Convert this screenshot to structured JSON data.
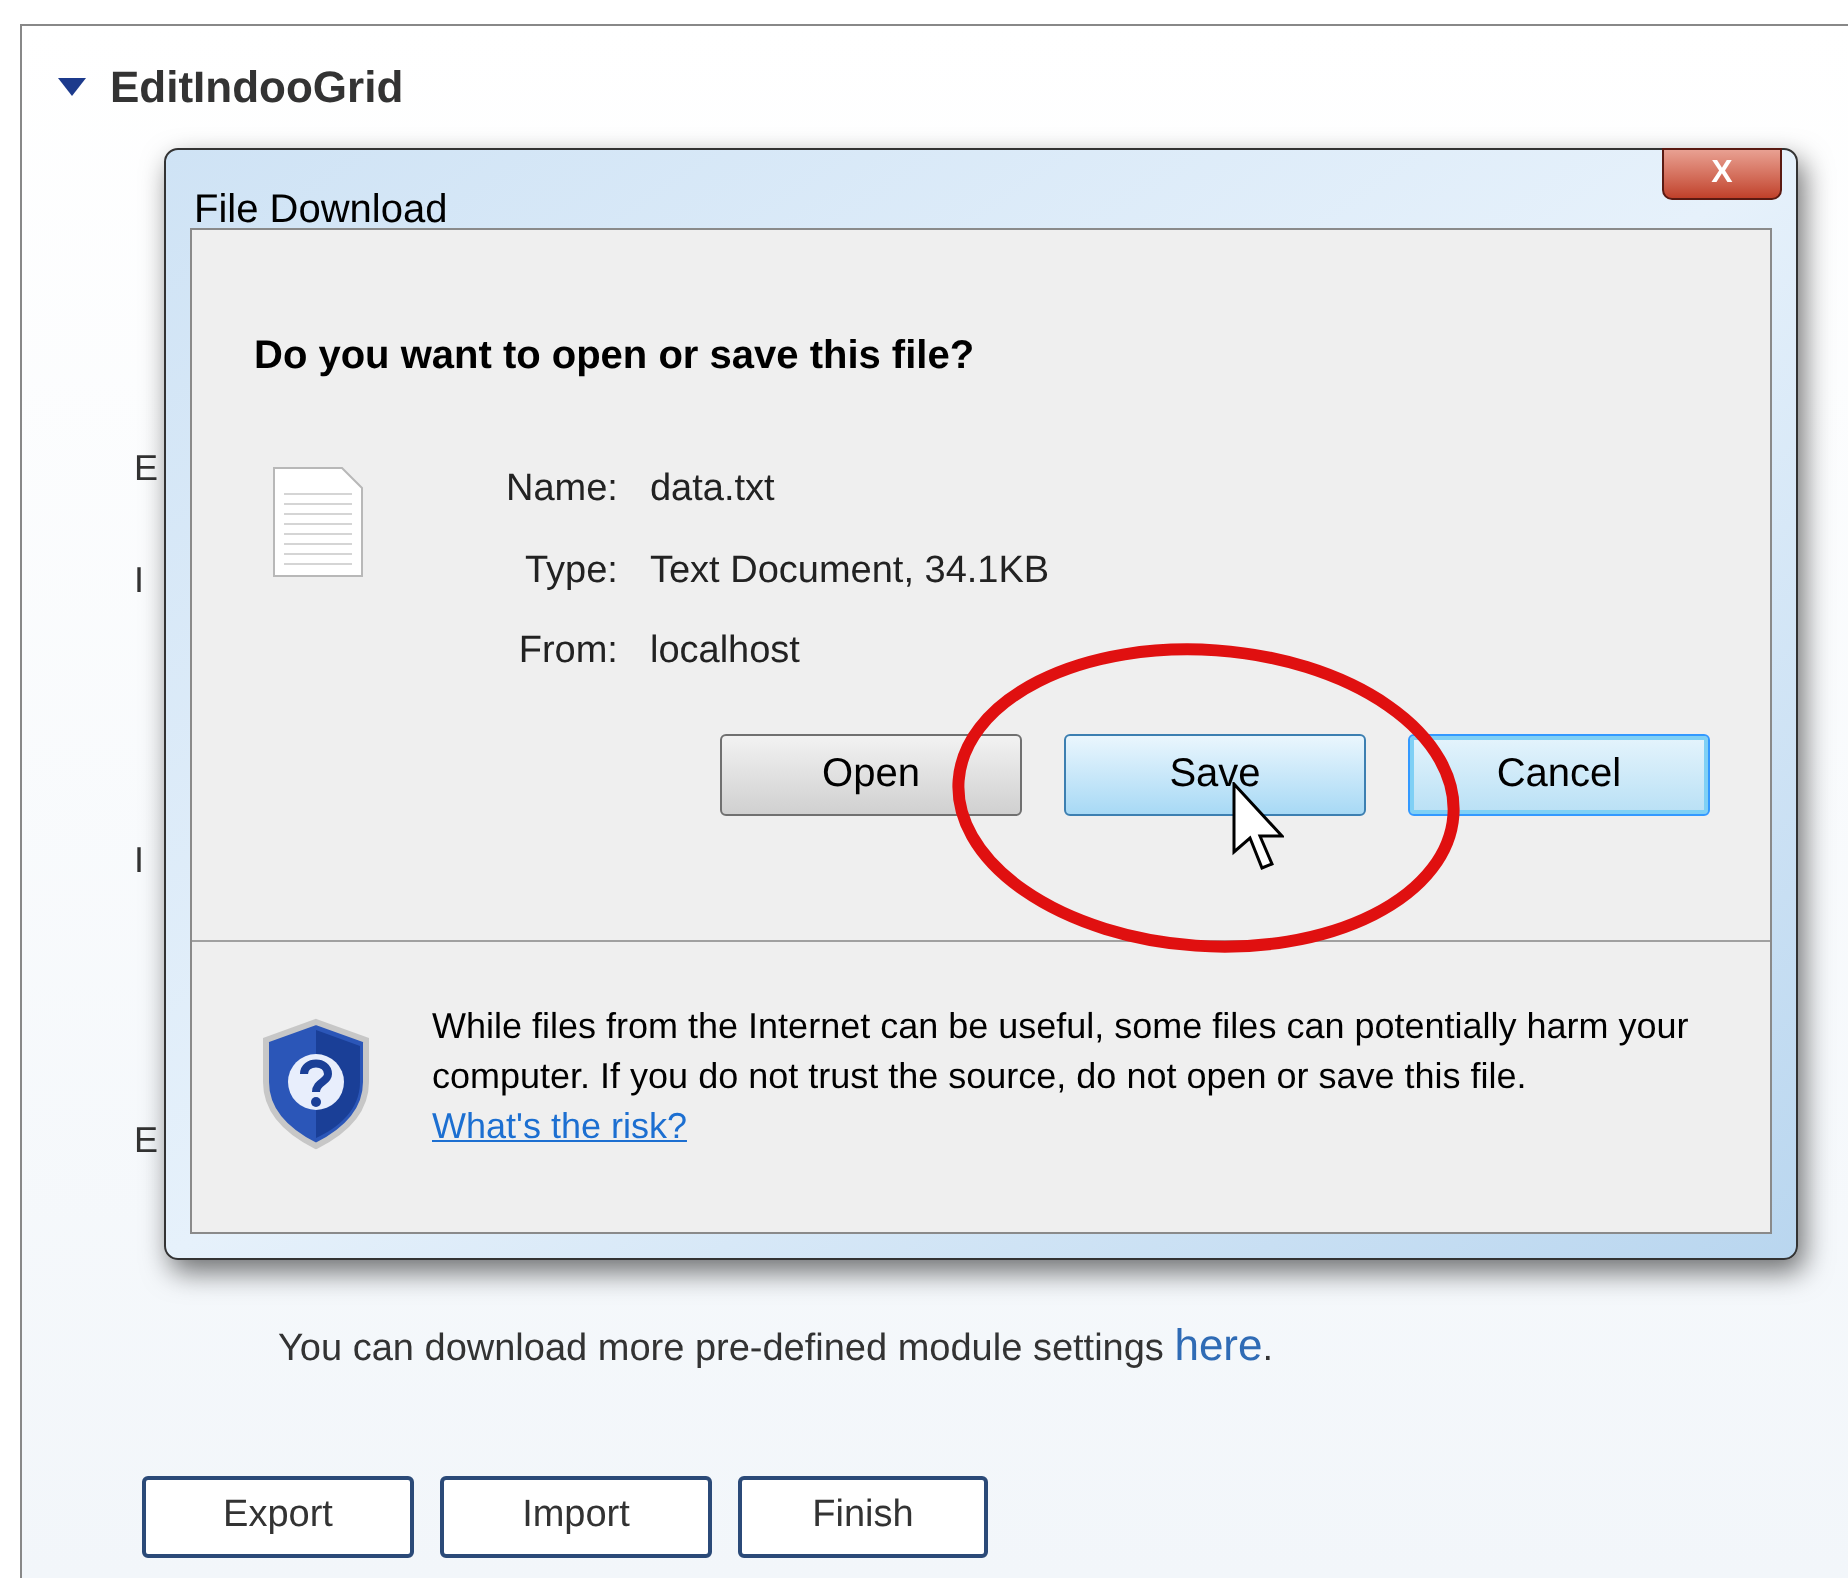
{
  "page": {
    "heading": "EditIndooGrid",
    "hidden_labels": [
      "E",
      "I",
      "I",
      "E"
    ],
    "note": "You can download more pre-defined module settings",
    "note_link": "here",
    "note_end": ".",
    "buttons": [
      "Export",
      "Import",
      "Finish"
    ]
  },
  "dialog": {
    "title": "File Download",
    "close": "X",
    "question": "Do you want to open or save this file?",
    "fields": [
      {
        "label": "Name:",
        "value": "data.txt"
      },
      {
        "label": "Type:",
        "value": "Text Document, 34.1KB"
      },
      {
        "label": "From:",
        "value": "localhost"
      }
    ],
    "buttons": [
      {
        "label": "Open",
        "kind": "normal"
      },
      {
        "label": "Save",
        "kind": "hover"
      },
      {
        "label": "Cancel",
        "kind": "default"
      }
    ],
    "warning": "While files from the Internet can be useful, some files can potentially harm your computer. If you do not trust the source, do not open or save this file.",
    "risk_link": "What's the risk?"
  }
}
